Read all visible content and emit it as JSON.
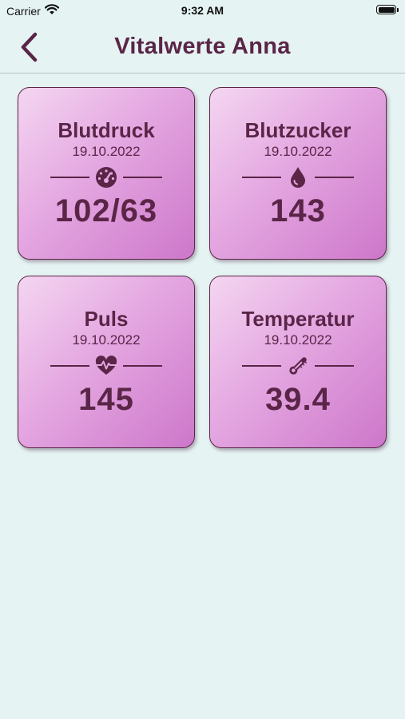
{
  "status_bar": {
    "carrier": "Carrier",
    "time": "9:32 AM"
  },
  "nav": {
    "title": "Vitalwerte Anna"
  },
  "cards": [
    {
      "title": "Blutdruck",
      "date": "19.10.2022",
      "value": "102/63",
      "icon": "gauge-icon"
    },
    {
      "title": "Blutzucker",
      "date": "19.10.2022",
      "value": "143",
      "icon": "drop-icon"
    },
    {
      "title": "Puls",
      "date": "19.10.2022",
      "value": "145",
      "icon": "heartbeat-icon"
    },
    {
      "title": "Temperatur",
      "date": "19.10.2022",
      "value": "39.4",
      "icon": "thermometer-icon"
    }
  ],
  "colors": {
    "background": "#e5f3f2",
    "accent": "#5a2547",
    "card_gradient_start": "#f4d6f1",
    "card_gradient_end": "#cd77ca"
  }
}
